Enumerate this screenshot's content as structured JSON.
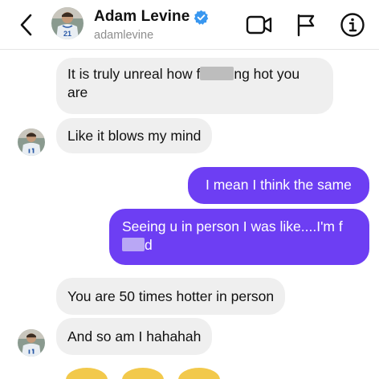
{
  "header": {
    "display_name": "Adam Levine",
    "username": "adamlevine",
    "avatar_jersey_number": "21"
  },
  "messages": [
    {
      "direction": "incoming",
      "parts": [
        "It is truly unreal how f",
        "ng hot you are"
      ],
      "censored": true
    },
    {
      "direction": "incoming",
      "text": "Like it blows my mind",
      "has_avatar": true
    },
    {
      "direction": "outgoing",
      "text": "I mean I think the same"
    },
    {
      "direction": "outgoing",
      "parts": [
        "Seeing u in person I was like....I'm f",
        "d"
      ],
      "censored": true
    },
    {
      "direction": "incoming",
      "text": "You are 50 times hotter in person"
    },
    {
      "direction": "incoming",
      "text": "And so am I hahahah",
      "has_avatar": true
    }
  ],
  "colors": {
    "outgoing_bubble": "#6d3ef3",
    "incoming_bubble": "#efefef",
    "verified_badge": "#3897f0",
    "reaction_emoji": "#f2c94c"
  },
  "icons": {
    "back": "chevron-left-icon",
    "verified": "verified-badge-icon",
    "video": "video-call-icon",
    "flag": "flag-icon",
    "info": "info-icon"
  }
}
